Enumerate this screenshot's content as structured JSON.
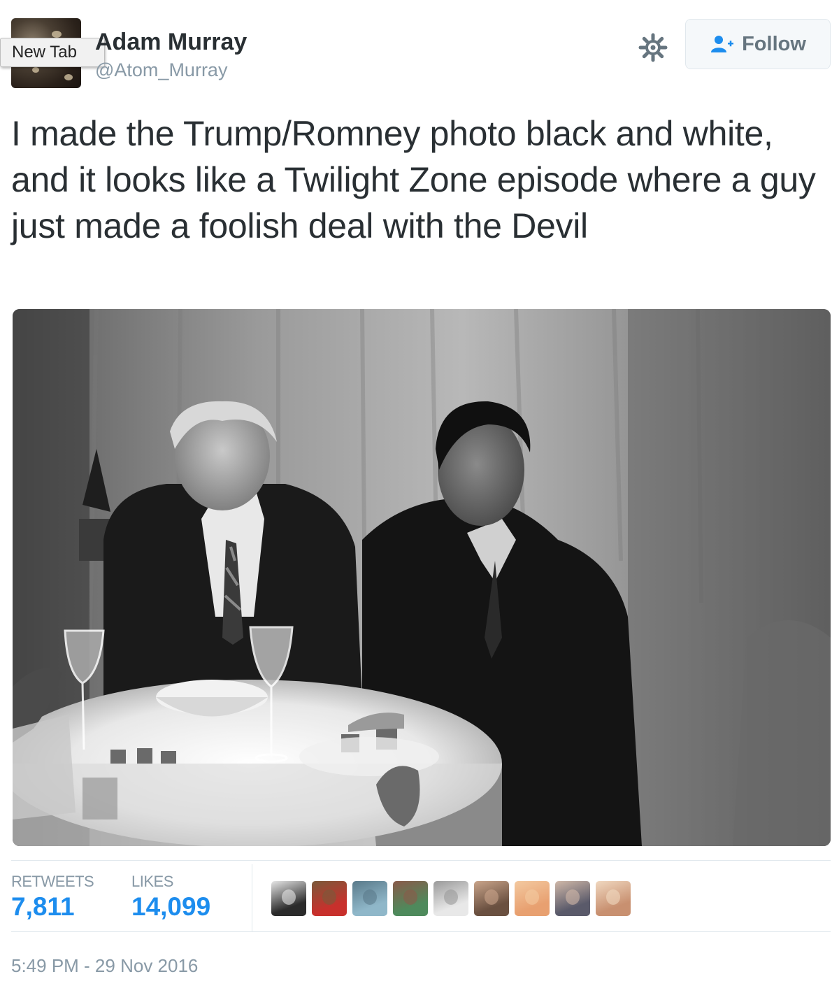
{
  "header": {
    "tooltip": "New Tab",
    "name": "Adam Murray",
    "handle": "@Atom_Murray",
    "follow_label": "Follow"
  },
  "tweet": {
    "text": "I made the Trump/Romney photo black and white, and it looks like a Twilight Zone episode where a guy just made a foolish deal with the Devil",
    "timestamp": "5:49 PM - 29 Nov 2016"
  },
  "stats": {
    "retweets_label": "RETWEETS",
    "retweets": "7,811",
    "likes_label": "LIKES",
    "likes": "14,099"
  },
  "likers": [
    {
      "name": "liker-avatar-1",
      "color": "#2b2b2b",
      "accent": "#e6e6e6"
    },
    {
      "name": "liker-avatar-2",
      "color": "#c8302c",
      "accent": "#7a5a3a"
    },
    {
      "name": "liker-avatar-3",
      "color": "#8fb7c9",
      "accent": "#5a7a8a"
    },
    {
      "name": "liker-avatar-4",
      "color": "#4e8a5c",
      "accent": "#8a5a4a"
    },
    {
      "name": "liker-avatar-5",
      "color": "#e8e8e8",
      "accent": "#9a9a9a"
    },
    {
      "name": "liker-avatar-6",
      "color": "#6a5040",
      "accent": "#c9a48a"
    },
    {
      "name": "liker-avatar-7",
      "color": "#e8a070",
      "accent": "#f3c9a0"
    },
    {
      "name": "liker-avatar-8",
      "color": "#5a5a6a",
      "accent": "#d0b8a8"
    },
    {
      "name": "liker-avatar-9",
      "color": "#c89070",
      "accent": "#f0d8c0"
    }
  ],
  "colors": {
    "link_blue": "#1d8dee",
    "muted_gray": "#8899a6",
    "text_dark": "#292f33"
  }
}
